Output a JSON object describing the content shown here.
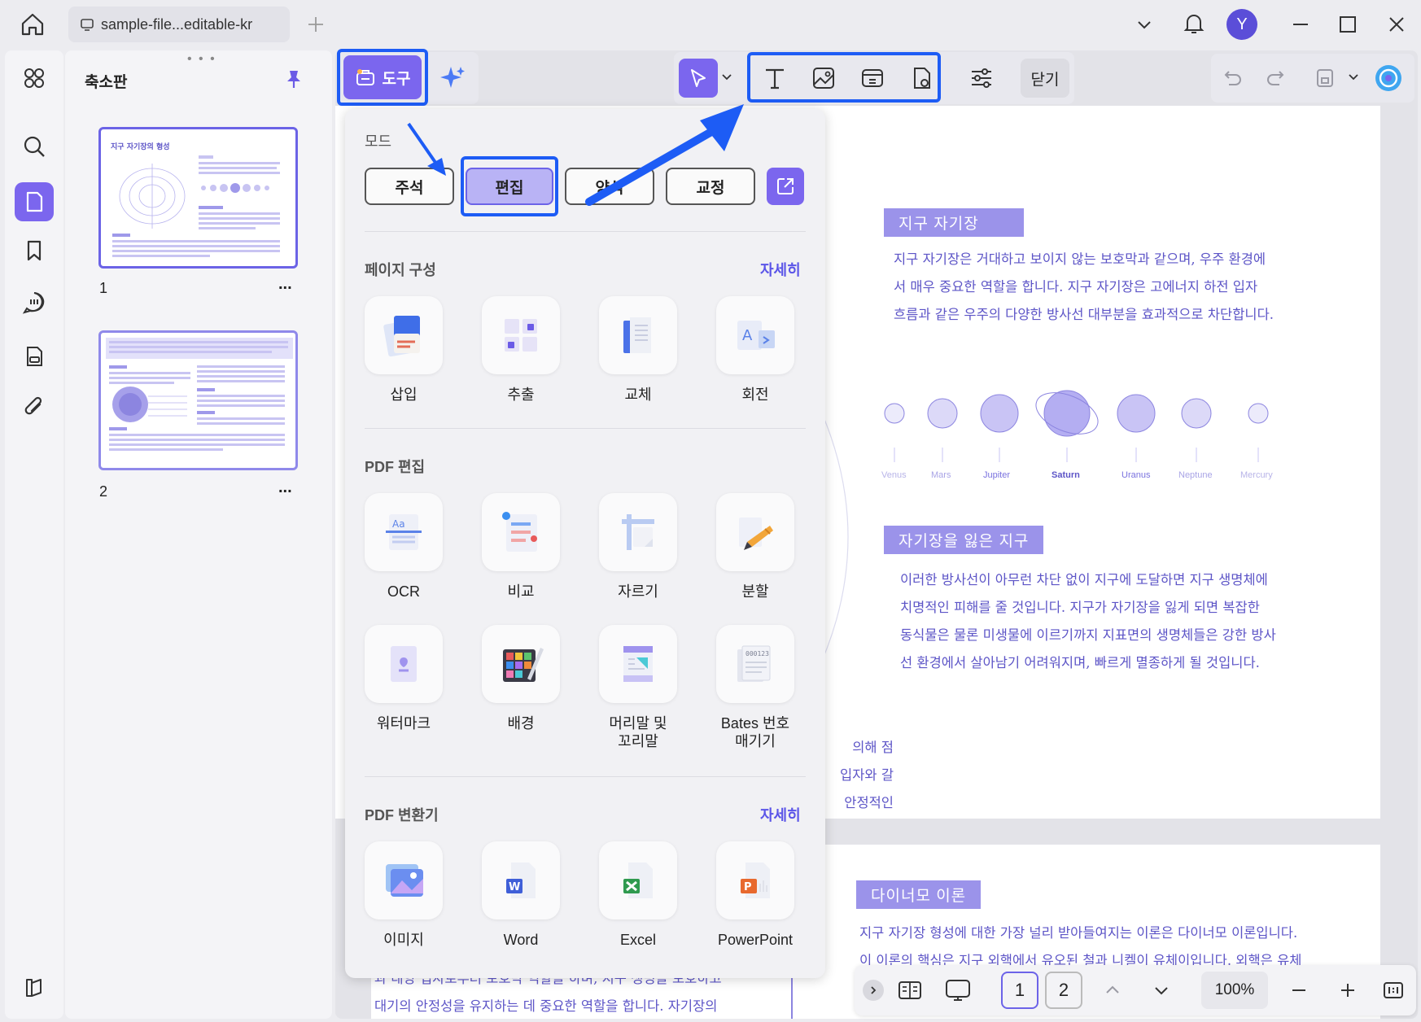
{
  "titlebar": {
    "tab_title": "sample-file...editable-kr",
    "avatar_letter": "Y"
  },
  "thumbs": {
    "title": "축소판",
    "pages": [
      {
        "number": "1",
        "title": "지구 자기장의 형성"
      },
      {
        "number": "2"
      }
    ],
    "more": "..."
  },
  "toolbar": {
    "tools_label": "도구",
    "close_label": "닫기"
  },
  "menu": {
    "mode_title": "모드",
    "modes": [
      "주석",
      "편집",
      "양식",
      "교정"
    ],
    "page_section_title": "페이지 구성",
    "pdf_edit_title": "PDF 편집",
    "converter_title": "PDF 변환기",
    "more_label": "자세히",
    "page_tools": [
      "삽입",
      "추출",
      "교체",
      "회전"
    ],
    "edit_tools_row1": [
      "OCR",
      "비교",
      "자르기",
      "분할"
    ],
    "edit_tools_row2": [
      "워터마크",
      "배경",
      "머리말 및\n꼬리말",
      "Bates 번호\n매기기"
    ],
    "convert_tools": [
      "이미지",
      "Word",
      "Excel",
      "PowerPoint"
    ]
  },
  "document": {
    "h1": "지구 자기장",
    "p1": [
      "지구 자기장은 거대하고 보이지 않는 보호막과 같으며, 우주 환경에",
      "서 매우 중요한 역할을 합니다. 지구 자기장은 고에너지 하전 입자",
      "흐름과 같은 우주의 다양한 방사선 대부분을 효과적으로 차단합니다."
    ],
    "planets": [
      "Venus",
      "Mars",
      "Jupiter",
      "Saturn",
      "Uranus",
      "Neptune",
      "Mercury"
    ],
    "h2": "자기장을 잃은 지구",
    "p2": [
      "이러한 방사선이 아무런 차단 없이 지구에 도달하면 지구 생명체에",
      "치명적인 피해를 줄 것입니다. 지구가 자기장을 잃게 되면 복잡한",
      "동식물은 물론 미생물에 이르기까지 지표면의 생명체들은 강한 방사",
      "선 환경에서 살아남기 어려워지며, 빠르게 멸종하게 될 것입니다."
    ],
    "partial_lines": [
      "의해 점",
      "입자와 갈",
      "안정적인"
    ],
    "h3": "다이너모 이론",
    "p3": [
      "지구 자기장 형성에 대한 가장 널리 받아들여지는 이론은 다이너모 이론입니다.",
      "이 이론의 핵심은 지구 외핵에서 유오된 철과 니켈이 유체이입니다. 외핵은 유체"
    ],
    "p_left": [
      "과 태양 입자로부터 보호막 역할을 하며, 지구 생명을 보호하고",
      "대기의 안정성을 유지하는 데 중요한 역할을 합니다. 자기장의"
    ]
  },
  "bottombar": {
    "page1": "1",
    "page2": "2",
    "zoom": "100%"
  },
  "colors": {
    "accent": "#7b66ee",
    "highlight": "#1d5cf5",
    "doc_text": "#5d55c7"
  }
}
